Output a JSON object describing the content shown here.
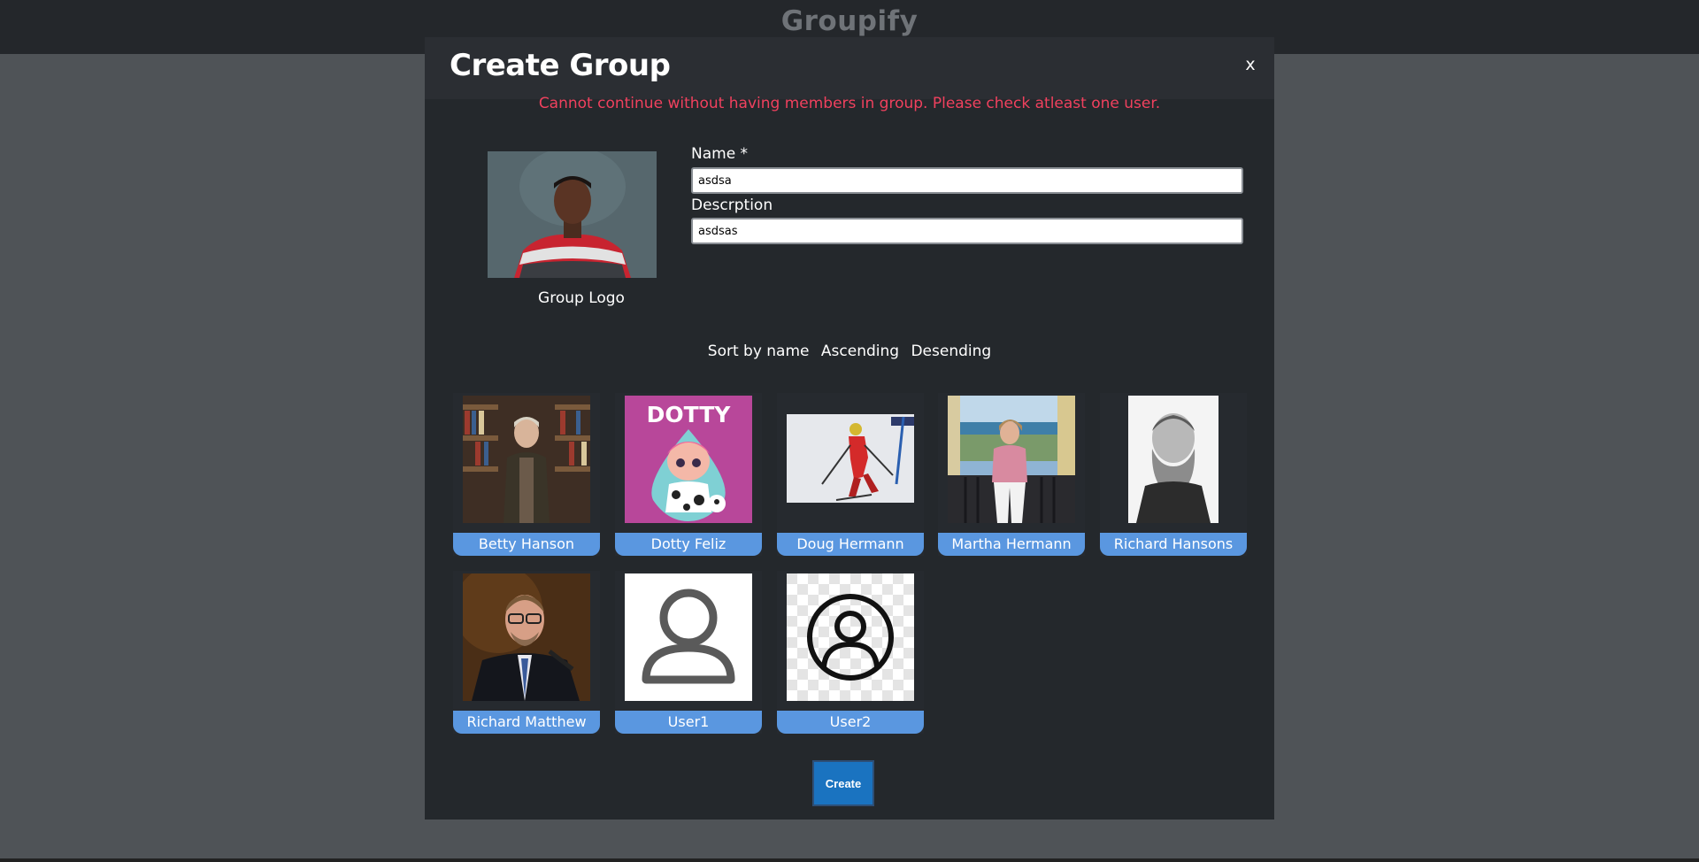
{
  "app": {
    "title": "Groupify"
  },
  "modal": {
    "title": "Create Group",
    "close_label": "x",
    "error": "Cannot continue without having members in group. Please check atleast one user."
  },
  "form": {
    "logo_caption": "Group Logo",
    "name_label": "Name *",
    "name_value": "asdsa",
    "description_label": "Descrption",
    "description_value": "asdsas"
  },
  "sort": {
    "label": "Sort by name",
    "ascending": "Ascending",
    "descending": "Desending"
  },
  "members": [
    {
      "name": "Betty Hanson"
    },
    {
      "name": "Dotty Feliz",
      "logo_text": "DOTTY"
    },
    {
      "name": "Doug Hermann"
    },
    {
      "name": "Martha Hermann"
    },
    {
      "name": "Richard Hansons"
    },
    {
      "name": "Richard Matthew"
    },
    {
      "name": "User1"
    },
    {
      "name": "User2"
    }
  ],
  "actions": {
    "create_label": "Create"
  },
  "colors": {
    "error": "#f0415e",
    "name_tag": "#5a97e0",
    "create_button": "#1a73c0",
    "modal_background": "#24282c"
  }
}
